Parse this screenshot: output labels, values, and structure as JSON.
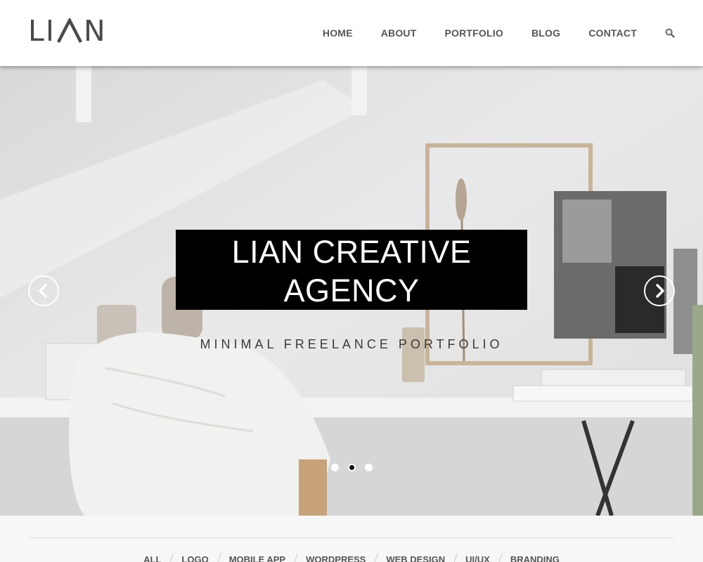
{
  "brand": {
    "logo_left": "L",
    "logo_mid": "I",
    "logo_right": "N"
  },
  "nav": {
    "items": [
      "HOME",
      "ABOUT",
      "PORTFOLIO",
      "BLOG",
      "CONTACT"
    ],
    "search_icon": "search-icon"
  },
  "hero": {
    "title_line1": "LIAN CREATIVE",
    "title_line2": "AGENCY",
    "subtitle": "MINIMAL FREELANCE PORTFOLIO",
    "prev_icon": "chevron-left-icon",
    "next_icon": "chevron-right-icon",
    "slides": 3,
    "active_slide": 2
  },
  "filters": [
    "ALL",
    "LOGO",
    "MOBILE APP",
    "WORDPRESS",
    "WEB DESIGN",
    "UI/UX",
    "BRANDING"
  ],
  "colors": {
    "header_bg": "#ffffff",
    "title_bg": "#000000",
    "text": "#555555",
    "hero_bg": "#e7e7e8"
  }
}
